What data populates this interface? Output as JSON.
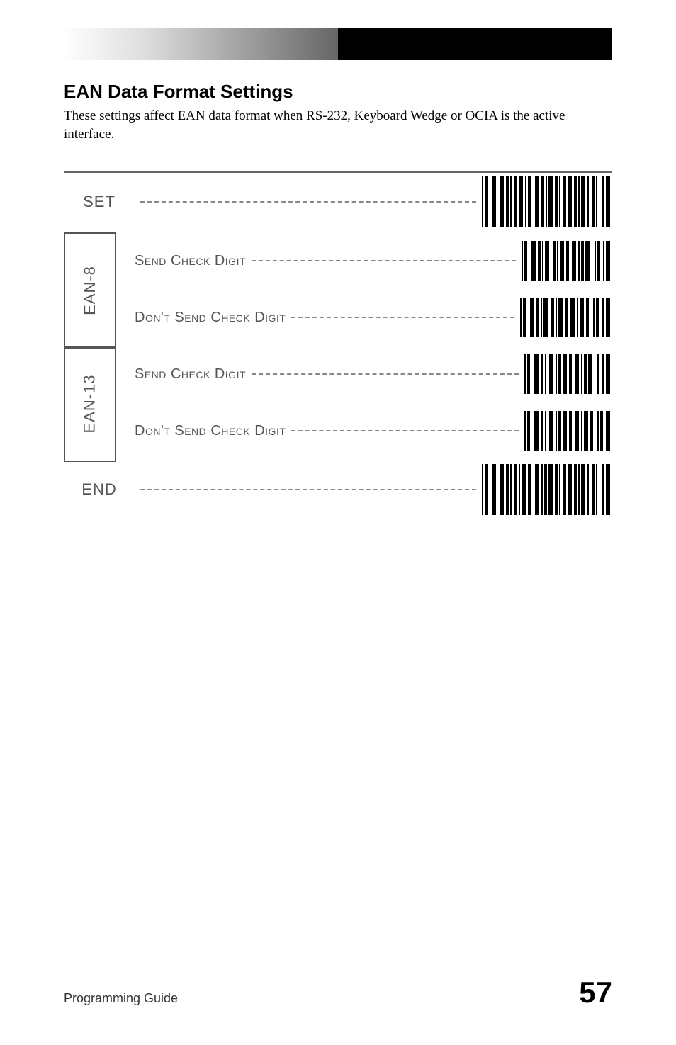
{
  "title": "EAN Data Format Settings",
  "intro": "These settings affect EAN data format when RS-232, Keyboard Wedge or OCIA is the active interface.",
  "rows": {
    "set": "SET",
    "end": "END"
  },
  "groups": {
    "ean8": "EAN-8",
    "ean13": "EAN-13"
  },
  "options": {
    "send": "Send Check Digit",
    "dontSend": "Don't Send Check Digit"
  },
  "footer": {
    "left": "Programming Guide",
    "page": "57"
  }
}
